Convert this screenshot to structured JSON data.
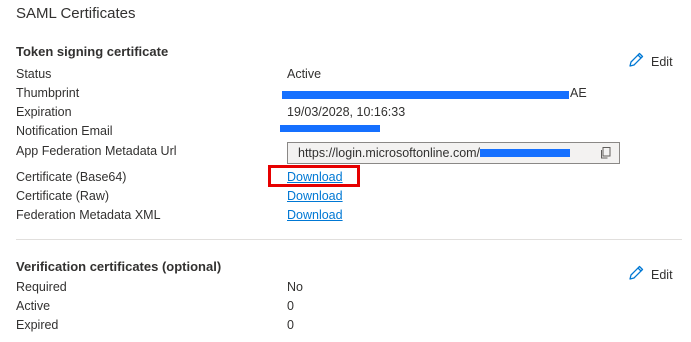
{
  "title": "SAML Certificates",
  "token_section": {
    "title": "Token signing certificate",
    "edit_label": "Edit",
    "fields": {
      "status": {
        "label": "Status",
        "value": "Active"
      },
      "thumbprint": {
        "label": "Thumbprint",
        "value_suffix": "AE"
      },
      "expiration": {
        "label": "Expiration",
        "value": "19/03/2028, 10:16:33"
      },
      "notification_email": {
        "label": "Notification Email"
      },
      "metadata_url": {
        "label": "App Federation Metadata Url",
        "value_prefix": "https://login.microsoftonline.com/"
      },
      "cert_base64": {
        "label": "Certificate (Base64)",
        "link": "Download"
      },
      "cert_raw": {
        "label": "Certificate (Raw)",
        "link": "Download"
      },
      "fed_metadata_xml": {
        "label": "Federation Metadata XML",
        "link": "Download"
      }
    }
  },
  "verification_section": {
    "title": "Verification certificates (optional)",
    "edit_label": "Edit",
    "fields": {
      "required": {
        "label": "Required",
        "value": "No"
      },
      "active": {
        "label": "Active",
        "value": "0"
      },
      "expired": {
        "label": "Expired",
        "value": "0"
      }
    }
  },
  "colors": {
    "link": "#0078d4",
    "redaction": "#1570ff",
    "highlight": "#e60000"
  },
  "icons": {
    "edit": "pencil-icon",
    "copy": "copy-icon"
  }
}
